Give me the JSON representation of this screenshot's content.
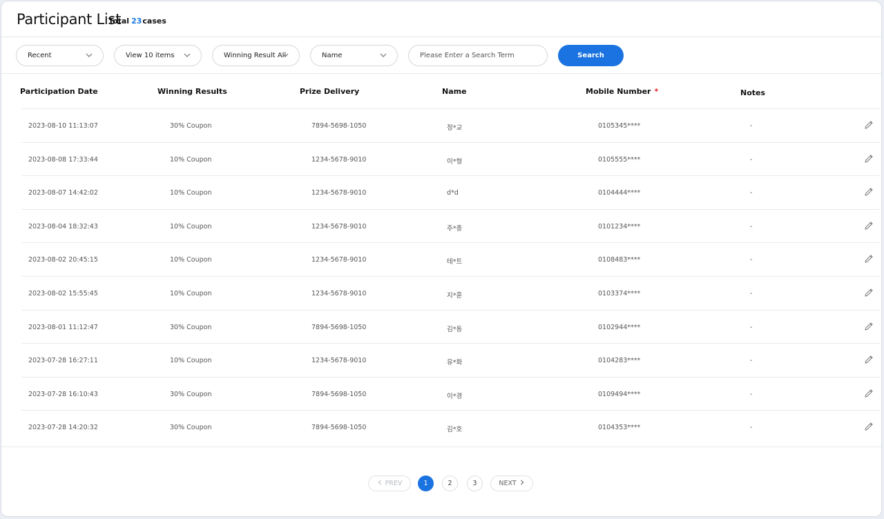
{
  "header": {
    "title": "Participant List",
    "total_prefix": "Total",
    "total_count": "23",
    "total_suffix": "cases"
  },
  "filters": {
    "sort": "Recent",
    "page_size": "View 10 items",
    "winning_result": "Winning Result All",
    "search_field": "Name",
    "search_placeholder": "Please Enter a Search Term",
    "search_button": "Search"
  },
  "table": {
    "columns": [
      "Participation Date",
      "Winning Results",
      "Prize Delivery",
      "Name",
      "Mobile Number",
      "Notes"
    ],
    "required_mark": "*",
    "rows": [
      {
        "date": "2023-08-10 11:13:07",
        "result": "30% Coupon",
        "prize": "7894-5698-1050",
        "name": "정*교",
        "mobile": "0105345****",
        "notes": "-"
      },
      {
        "date": "2023-08-08 17:33:44",
        "result": "10% Coupon",
        "prize": "1234-5678-9010",
        "name": "이*형",
        "mobile": "0105555****",
        "notes": "-"
      },
      {
        "date": "2023-08-07 14:42:02",
        "result": "10% Coupon",
        "prize": "1234-5678-9010",
        "name": "d*d",
        "mobile": "0104444****",
        "notes": "-"
      },
      {
        "date": "2023-08-04 18:32:43",
        "result": "10% Coupon",
        "prize": "1234-5678-9010",
        "name": "주*종",
        "mobile": "0101234****",
        "notes": "-"
      },
      {
        "date": "2023-08-02 20:45:15",
        "result": "10% Coupon",
        "prize": "1234-5678-9010",
        "name": "테*트",
        "mobile": "0108483****",
        "notes": "-"
      },
      {
        "date": "2023-08-02 15:55:45",
        "result": "10% Coupon",
        "prize": "1234-5678-9010",
        "name": "지*훈",
        "mobile": "0103374****",
        "notes": "-"
      },
      {
        "date": "2023-08-01 11:12:47",
        "result": "30% Coupon",
        "prize": "7894-5698-1050",
        "name": "김*동",
        "mobile": "0102944****",
        "notes": "-"
      },
      {
        "date": "2023-07-28 16:27:11",
        "result": "10% Coupon",
        "prize": "1234-5678-9010",
        "name": "유*화",
        "mobile": "0104283****",
        "notes": "-"
      },
      {
        "date": "2023-07-28 16:10:43",
        "result": "30% Coupon",
        "prize": "7894-5698-1050",
        "name": "이*경",
        "mobile": "0109494****",
        "notes": "-"
      },
      {
        "date": "2023-07-28 14:20:32",
        "result": "30% Coupon",
        "prize": "7894-5698-1050",
        "name": "김*호",
        "mobile": "0104353****",
        "notes": "-"
      }
    ]
  },
  "pagination": {
    "prev": "PREV",
    "next": "NEXT",
    "pages": [
      "1",
      "2",
      "3"
    ],
    "current": "1"
  },
  "icons": {
    "dropdown": "chevron-down-icon",
    "edit": "pencil-icon",
    "prev": "chevron-left-icon",
    "next": "chevron-right-icon"
  },
  "colors": {
    "accent": "#1a73e0",
    "required": "#e02424"
  }
}
